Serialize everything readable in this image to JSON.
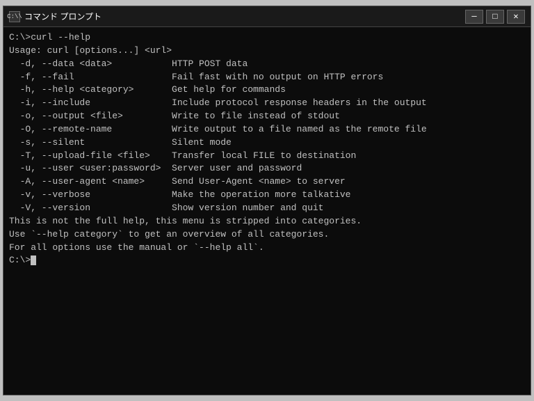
{
  "window": {
    "title": "コマンド プロンプト",
    "icon_label": "C:\\",
    "min_btn": "─",
    "max_btn": "□",
    "close_btn": "✕"
  },
  "terminal": {
    "lines": [
      {
        "text": "C:\\>curl --help"
      },
      {
        "text": "Usage: curl [options...] <url>"
      },
      {
        "text": "  -d, --data <data>           HTTP POST data"
      },
      {
        "text": "  -f, --fail                  Fail fast with no output on HTTP errors"
      },
      {
        "text": "  -h, --help <category>       Get help for commands"
      },
      {
        "text": "  -i, --include               Include protocol response headers in the output"
      },
      {
        "text": "  -o, --output <file>         Write to file instead of stdout"
      },
      {
        "text": "  -O, --remote-name           Write output to a file named as the remote file"
      },
      {
        "text": "  -s, --silent                Silent mode"
      },
      {
        "text": "  -T, --upload-file <file>    Transfer local FILE to destination"
      },
      {
        "text": "  -u, --user <user:password>  Server user and password"
      },
      {
        "text": "  -A, --user-agent <name>     Send User-Agent <name> to server"
      },
      {
        "text": "  -v, --verbose               Make the operation more talkative"
      },
      {
        "text": "  -V, --version               Show version number and quit"
      },
      {
        "text": ""
      },
      {
        "text": "This is not the full help, this menu is stripped into categories."
      },
      {
        "text": "Use `--help category` to get an overview of all categories."
      },
      {
        "text": "For all options use the manual or `--help all`."
      },
      {
        "text": ""
      },
      {
        "text": "C:\\>"
      }
    ]
  }
}
